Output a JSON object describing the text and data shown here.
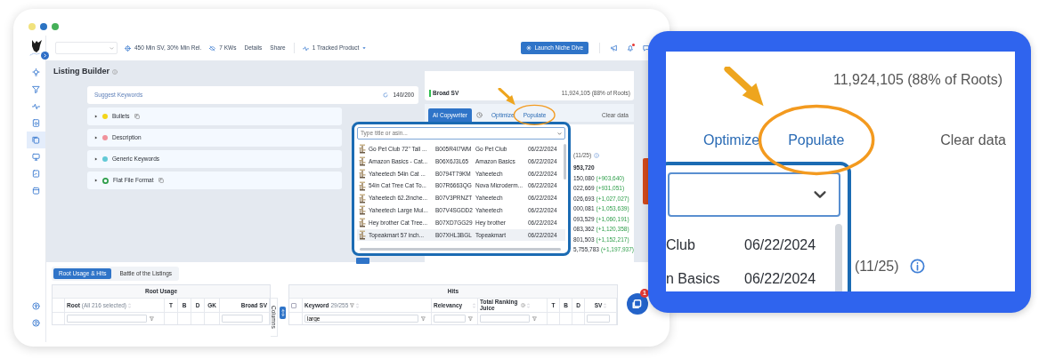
{
  "window": {
    "lights": [
      {
        "color": "#f1e27d"
      },
      {
        "color": "#2b73c2"
      },
      {
        "color": "#45b058"
      }
    ]
  },
  "toolbar": {
    "filters": "450 Min SV, 30% Min Rel.",
    "keywords": "7 KWs",
    "links": [
      "Details",
      "Share"
    ],
    "tracked": "1 Tracked Product",
    "launch": "Launch Niche Dive",
    "unread": true
  },
  "sidebar": {
    "items": [
      {
        "selected": false
      },
      {
        "selected": false
      },
      {
        "selected": false
      },
      {
        "selected": false
      },
      {
        "selected": true
      },
      {
        "selected": false
      },
      {
        "selected": false
      },
      {
        "selected": false
      }
    ]
  },
  "page": {
    "title": "Listing Builder"
  },
  "builder": {
    "suggest": "Suggest Keywords",
    "count": "140/200",
    "sections": [
      {
        "kind": "dot",
        "label": "Bullets",
        "color": "#f3d51a",
        "copy": true
      },
      {
        "kind": "dot",
        "label": "Description",
        "color": "#f0929c",
        "copy": false
      },
      {
        "kind": "dot",
        "label": "Generic Keywords",
        "color": "#62c9d6",
        "copy": false
      },
      {
        "kind": "ring",
        "label": "Flat File Format",
        "color": "#2e9e4a",
        "copy": true
      }
    ]
  },
  "summary": {
    "label": "Broad SV",
    "value": "11,924,105 (88% of Roots)",
    "color": "#2fbf4f"
  },
  "tabs": [
    {
      "kind": "text",
      "label": "AI Copywriter",
      "selected": true,
      "circled": false
    },
    {
      "kind": "icon",
      "selected": false,
      "circled": false
    },
    {
      "kind": "text",
      "label": "Optimize",
      "selected": false,
      "circled": false
    },
    {
      "kind": "text",
      "label": "Populate",
      "selected": false,
      "circled": true
    }
  ],
  "clear_data": "Clear data",
  "results": {
    "count": "(11/25)",
    "rows": [
      {
        "value": "953,720"
      },
      {
        "value": "150,080",
        "delta": "(+903,640)"
      },
      {
        "value": "022,669",
        "delta": "(+931,051)"
      },
      {
        "value": "026,693",
        "delta": "(+1,027,027)"
      },
      {
        "value": "000,081",
        "delta": "(+1,053,639)"
      },
      {
        "value": "093,529",
        "delta": "(+1,060,191)"
      },
      {
        "value": "083,362",
        "delta": "(+1,120,358)"
      },
      {
        "value": "801,503",
        "delta": "(+1,152,217)"
      },
      {
        "value": "5,755,783",
        "delta": "(+1,197,937)"
      }
    ]
  },
  "picker": {
    "placeholder": "Type title or asin...",
    "items": [
      {
        "title": "Go Pet Club 72\" Tall ...",
        "asin": "B005R4I7WM",
        "brand": "Go Pet Club",
        "date": "06/22/2024",
        "selected": false
      },
      {
        "title": "Amazon Basics - Cat...",
        "asin": "B06X6J3L65",
        "brand": "Amazon Basics",
        "date": "06/22/2024",
        "selected": false
      },
      {
        "title": "Yaheetech 54in Cat ...",
        "asin": "B0794T79KM",
        "brand": "Yaheetech",
        "date": "06/22/2024",
        "selected": false
      },
      {
        "title": "54in Cat Tree Cat To...",
        "asin": "B07R6663QG",
        "brand": "Nova Microderm...",
        "date": "06/22/2024",
        "selected": false
      },
      {
        "title": "Yaheetech 62.2inche...",
        "asin": "B07V3PRNZT",
        "brand": "Yaheetech",
        "date": "06/22/2024",
        "selected": false
      },
      {
        "title": "Yaheetech Large Mul...",
        "asin": "B07V4SGDD2",
        "brand": "Yaheetech",
        "date": "06/22/2024",
        "selected": false
      },
      {
        "title": "Hey brother Cat Tree...",
        "asin": "B07XD7GG29",
        "brand": "Hey brother",
        "date": "06/22/2024",
        "selected": false
      },
      {
        "title": "Topeakmart 57 inch...",
        "asin": "B07XHL3BGL",
        "brand": "Topeakmart",
        "date": "06/22/2024",
        "selected": true
      }
    ]
  },
  "bottom": {
    "tabs": [
      {
        "label": "Root Usage & Hits",
        "selected": true
      },
      {
        "label": "Battle of the Listings",
        "selected": false
      }
    ],
    "root_usage": {
      "title": "Root Usage",
      "root": "Root",
      "root_note": "(All 216 selected)",
      "columns": [
        "T",
        "B",
        "D",
        "GK",
        "Broad SV"
      ],
      "side": "Columns"
    },
    "hits": {
      "title": "Hits",
      "all_checked": false,
      "keyword": "Keyword",
      "keyword_note": "29/255",
      "columns": [
        "Relevancy",
        "Total Ranking Juice",
        "T",
        "B",
        "D",
        "SV"
      ],
      "filter": "large"
    }
  },
  "chat": {
    "badge": "1"
  },
  "callout": {
    "summary": "11,924,105 (88% of Roots)",
    "tabs": [
      {
        "kind": "tab",
        "label": "Optimize",
        "circled": false
      },
      {
        "kind": "tab",
        "label": "Populate",
        "circled": true
      },
      {
        "kind": "action",
        "label": "Clear data",
        "circled": false
      }
    ],
    "rows": [
      {
        "label": "Club",
        "date": "06/22/2024"
      },
      {
        "label": "n Basics",
        "date": "06/22/2024"
      }
    ],
    "count": "(11/25)"
  }
}
